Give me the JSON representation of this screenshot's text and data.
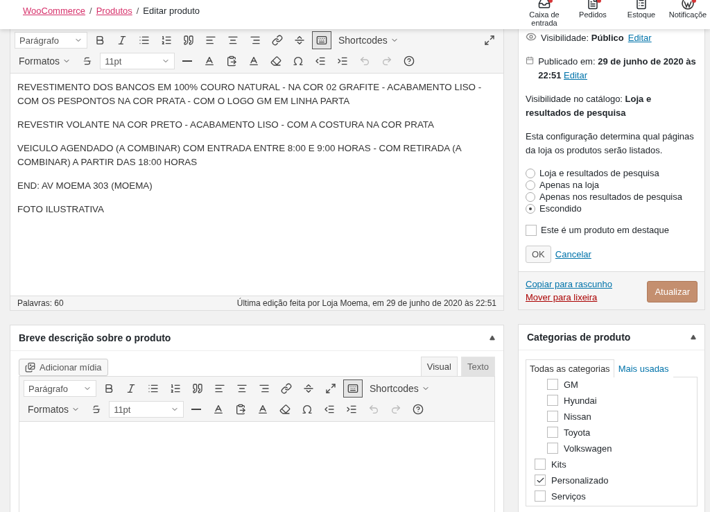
{
  "breadcrumbs": {
    "links": [
      "WooCommerce",
      "Produtos"
    ],
    "separator": "/",
    "current": "Editar produto"
  },
  "header_actions": [
    {
      "label": "Caixa de entrada",
      "kind": "inbox",
      "badge": true
    },
    {
      "label": "Pedidos",
      "kind": "orders",
      "badge": true
    },
    {
      "label": "Estoque",
      "kind": "stock",
      "badge": false
    },
    {
      "label": "Notificaçõe",
      "kind": "wordpress",
      "badge": true
    }
  ],
  "editor": {
    "format": "Parágrafo",
    "formats_menu": "Formatos",
    "font_size": "11pt",
    "shortcodes": "Shortcodes",
    "toolbar_toggle_on": true,
    "paragraphs": [
      "REVESTIMENTO DOS BANCOS EM 100% COURO NATURAL - NA COR 02 GRAFITE - ACABAMENTO LISO - COM OS PESPONTOS NA COR PRATA - COM O LOGO GM EM LINHA PARTA",
      "REVESTIR VOLANTE NA COR PRETO - ACABAMENTO LISO - COM A COSTURA NA COR PRATA",
      "VEICULO AGENDADO (A COMBINAR) COM ENTRADA ENTRE 8:00 E 9:00 HORAS - COM RETIRADA (A COMBINAR) A PARTIR DAS 18:00 HORAS",
      "END: AV MOEMA 303 (MOEMA)",
      "FOTO ILUSTRATIVA"
    ],
    "word_count": "Palavras: 60",
    "last_edit": "Última edição feita por Loja Moema, em 29 de junho de 2020 às 22:51"
  },
  "short_description": {
    "title": "Breve descrição sobre o produto",
    "add_media": "Adicionar mídia",
    "tabs": [
      {
        "label": "Visual",
        "selected": true
      },
      {
        "label": "Texto",
        "selected": false
      }
    ],
    "format": "Parágrafo",
    "formats_menu": "Formatos",
    "font_size": "11pt",
    "shortcodes": "Shortcodes",
    "toolbar_toggle_on": true
  },
  "publish": {
    "visibility": "Visibilidade: **Público**",
    "visibility_edit": "Editar",
    "published": "Publicado em: **29 de junho de 2020 às 22:51**",
    "published_edit": "Editar",
    "catalog_visibility": "Visibilidade no catálogo: **Loja e resultados de pesquisa**",
    "help": "Esta configuração determina qual páginas da loja os produtos serão listados.",
    "options": [
      {
        "label": "Loja e resultados de pesquisa",
        "selected": false
      },
      {
        "label": "Apenas na loja",
        "selected": false
      },
      {
        "label": "Apenas nos resultados de pesquisa",
        "selected": false
      },
      {
        "label": "Escondido",
        "selected": true
      }
    ],
    "featured": {
      "label": "Este é um produto em destaque",
      "checked": false
    },
    "ok": "OK",
    "cancel": "Cancelar",
    "copy_draft": "Copiar para rascunho",
    "trash": "Mover para lixeira",
    "update": "Atualizar"
  },
  "categories": {
    "title": "Categorias de produto",
    "tabs": [
      {
        "label": "Todas as categorias",
        "selected": true
      },
      {
        "label": "Mais usadas",
        "selected": false
      }
    ],
    "subcategories": [
      {
        "label": "GM",
        "checked": false
      },
      {
        "label": "Hyundai",
        "checked": false
      },
      {
        "label": "Nissan",
        "checked": false
      },
      {
        "label": "Toyota",
        "checked": false
      },
      {
        "label": "Volkswagen",
        "checked": false
      }
    ],
    "items": [
      {
        "label": "Kits",
        "checked": false
      },
      {
        "label": "Personalizado",
        "checked": true
      },
      {
        "label": "Serviços",
        "checked": false
      }
    ]
  }
}
